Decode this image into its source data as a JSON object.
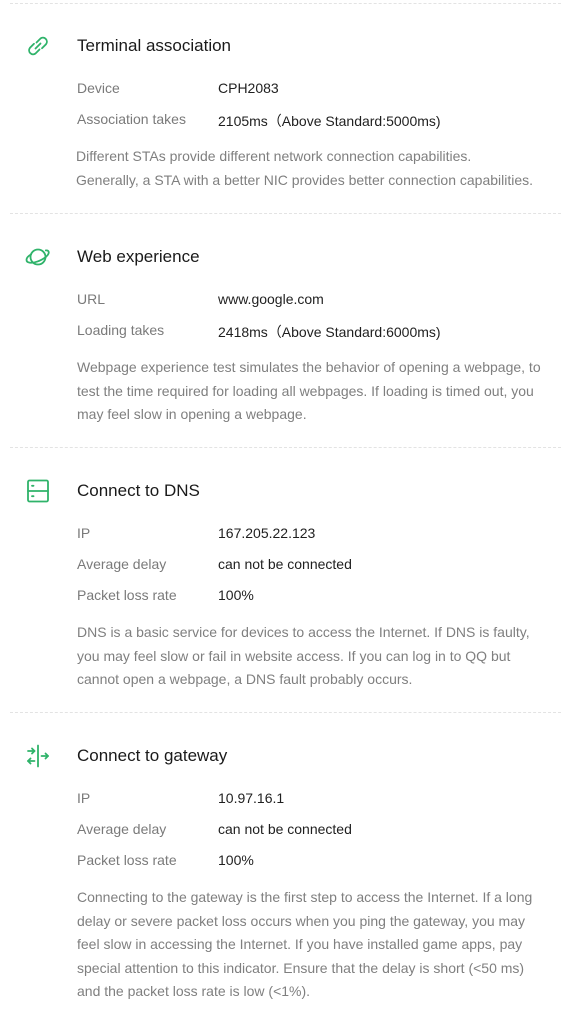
{
  "colors": {
    "accent": "#2fb36a",
    "label": "#7a7a7a",
    "value": "#1f1f1f",
    "description": "#7f7f7f",
    "divider": "#e3e3e3"
  },
  "sections": [
    {
      "icon": "link-icon",
      "title": "Terminal association",
      "rows": [
        {
          "label": "Device",
          "value": "CPH2083"
        },
        {
          "label": "Association takes",
          "value": "2105ms（Above Standard:5000ms)"
        }
      ],
      "description": "Different STAs provide different network connection capabilities.\n Generally, a STA with a better NIC provides better connection capabilities."
    },
    {
      "icon": "planet-icon",
      "title": "Web experience",
      "rows": [
        {
          "label": "URL",
          "value": "www.google.com"
        },
        {
          "label": "Loading takes",
          "value": "2418ms（Above Standard:6000ms)"
        }
      ],
      "description": "Webpage experience test simulates the behavior of opening a webpage, to test the time required for loading all webpages. If loading is timed out, you may feel slow in opening a webpage."
    },
    {
      "icon": "server-icon",
      "title": "Connect to DNS",
      "rows": [
        {
          "label": "IP",
          "value": "167.205.22.123"
        },
        {
          "label": "Average delay",
          "value": "can not be connected"
        },
        {
          "label": "Packet loss rate",
          "value": "100%"
        }
      ],
      "description": "DNS is a basic service for devices to access the Internet. If DNS is faulty, you may feel slow or fail in website access. If you can log in to QQ but cannot open a webpage, a DNS fault probably occurs."
    },
    {
      "icon": "gateway-arrows-icon",
      "title": "Connect to gateway",
      "rows": [
        {
          "label": "IP",
          "value": "10.97.16.1"
        },
        {
          "label": "Average delay",
          "value": "can not be connected"
        },
        {
          "label": "Packet loss rate",
          "value": "100%"
        }
      ],
      "description": "Connecting to the gateway is the first step to access the Internet. If a long delay or severe packet loss occurs when you ping the gateway, you may feel slow in accessing the Internet. If you have installed game apps, pay special attention to this indicator. Ensure that the delay is short (<50 ms) and the packet loss rate is low (<1%)."
    }
  ]
}
